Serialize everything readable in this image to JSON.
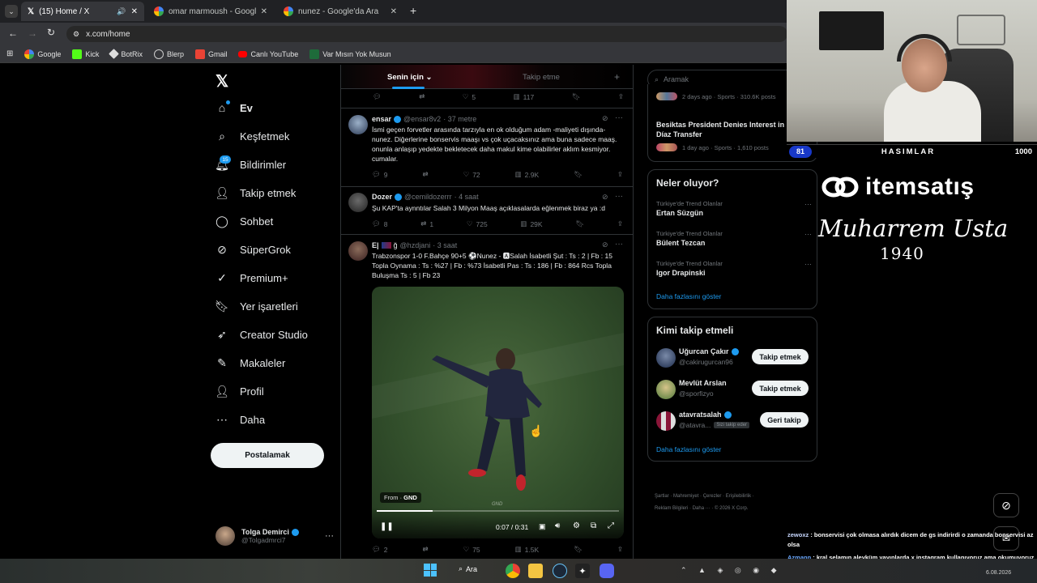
{
  "browser": {
    "tabs": [
      {
        "label": "(15) Home / X",
        "active": true
      },
      {
        "label": "omar marmoush - Google'da A",
        "active": false
      },
      {
        "label": "nunez - Google'da Ara",
        "active": false
      }
    ],
    "url": "x.com/home",
    "bookmarks": [
      "Google",
      "Kick",
      "BotRix",
      "Blerp",
      "Gmail",
      "Canlı YouTube",
      "Var Mısın Yok Musun"
    ]
  },
  "sidebar": {
    "items": [
      {
        "label": "Ev",
        "icon": "home-icon"
      },
      {
        "label": "Keşfetmek",
        "icon": "search-icon"
      },
      {
        "label": "Bildirimler",
        "icon": "bell-icon",
        "badge": "15"
      },
      {
        "label": "Takip etmek",
        "icon": "person-add-icon"
      },
      {
        "label": "Sohbet",
        "icon": "chat-icon"
      },
      {
        "label": "SüperGrok",
        "icon": "grok-icon"
      },
      {
        "label": "Premium+",
        "icon": "premium-icon"
      },
      {
        "label": "Yer işaretleri",
        "icon": "bookmark-icon"
      },
      {
        "label": "Creator Studio",
        "icon": "rocket-icon"
      },
      {
        "label": "Makaleler",
        "icon": "article-icon"
      },
      {
        "label": "Profil",
        "icon": "profile-icon"
      },
      {
        "label": "Daha",
        "icon": "more-circle-icon"
      }
    ],
    "post_button": "Postalamak",
    "account": {
      "name": "Tolga Demirci",
      "handle": "@Tolgadmrci7"
    }
  },
  "feed": {
    "tabs": [
      "Senin için",
      "Takip etme"
    ],
    "top_stats": {
      "replies": "",
      "likes": "5",
      "views": "117"
    },
    "tweets": [
      {
        "name": "ensar",
        "handle": "@ensar8v2",
        "time": "· 37 metre",
        "text": "İsmi geçen forvetler arasında tarzıyla en ok olduğum adam -maliyeti dışında- nunez. Diğerlerine bonservis maaşı vs çok uçacaksınız ama buna sadece maaş. onunla anlaşıp yedekte bekletecek daha makul kime olabilirler aklım kesmiyor. cumalar.",
        "replies": "9",
        "retweets": "",
        "likes": "72",
        "views": "2.9K"
      },
      {
        "name": "Dozer",
        "handle": "@cemildozerrr",
        "time": "· 4 saat",
        "text": "Şu KAP'ta aynntılar Salah 3 Milyon Maaş açıklasalarda eğlenmek biraz ya :d",
        "replies": "8",
        "retweets": "1",
        "likes": "725",
        "views": "29K"
      },
      {
        "name": "E|",
        "handle": "@hzdjani",
        "time": "· 3 saat",
        "text": "Trabzonspor 1-0 F.Bahçe 90+5 ⚽Nunez - 🅰Salah İsabetli Şut : Ts : 2 | Fb : 15 Topla Oynama : Ts : %27 | Fb : %73 İsabetli Pas : Ts : 186 | Fb : 864 Rcs Topla Buluşma Ts : 5 | Fb 23",
        "video": {
          "from_label": "From",
          "source": "GND",
          "watermark": "GND",
          "time": "0:07 / 0:31",
          "progress": 0.23
        },
        "replies": "2",
        "retweets": "",
        "likes": "75",
        "views": "1.5K"
      }
    ]
  },
  "right": {
    "search_placeholder": "Aramak",
    "top_news": [
      {
        "meta": "2 days ago · Sports · 310.6K posts"
      },
      {
        "title": "Besiktas President Denies Interest in Brahim Díaz Transfer",
        "meta": "1 day ago · Sports · 1,610 posts"
      }
    ],
    "trends_title": "Neler oluyor?",
    "trends": [
      {
        "meta": "Türkiye'de Trend Olanlar",
        "name": "Ertan Süzgün"
      },
      {
        "meta": "Türkiye'de Trend Olanlar",
        "name": "Bülent Tezcan"
      },
      {
        "meta": "Türkiye'de Trend Olanlar",
        "name": "Igor Drapinski"
      }
    ],
    "show_more": "Daha fazlasını göster",
    "who_title": "Kimi takip etmeli",
    "who": [
      {
        "name": "Uğurcan Çakır",
        "handle": "@cakirugurcan96",
        "button": "Takip etmek"
      },
      {
        "name": "Mevlüt Arslan",
        "handle": "@sporfizyo",
        "button": "Takip etmek"
      },
      {
        "name": "atavratsalah",
        "handle": "@atavra...",
        "follows_you": "Sizi takip eder",
        "button": "Geri takip"
      }
    ],
    "who_more": "Daha fazlasını göster",
    "footer": [
      "Şartlar",
      "Mahremiyet",
      "Çerezler",
      "Erişilebilirlik",
      "Reklam Bilgileri",
      "Daha ···",
      "© 2026 X Corp."
    ]
  },
  "overlay": {
    "score_left": "81",
    "score_title": "HASIMLAR",
    "score_right": "1000",
    "sponsor": "itemsatış",
    "signature": "Muharrem Usta",
    "year": "1940",
    "chat": [
      {
        "user": "zewoxz",
        "text": " : bonservisi çok olmasa alırdık dicem de gs indirirdi o zamanda bonservisi az olsa"
      },
      {
        "user": "Azmann",
        "text": " : kral selamın aleyküm yayınlarda x instagram kullanıyoruz ama okumuyoruz yayında yakınlaştırmak gerekiyor senden ricam biraz büyültüp yapar mısın d insta yayınlarını teşekkürler"
      }
    ]
  },
  "taskbar": {
    "search": "Ara",
    "date": "6.08.2026"
  }
}
